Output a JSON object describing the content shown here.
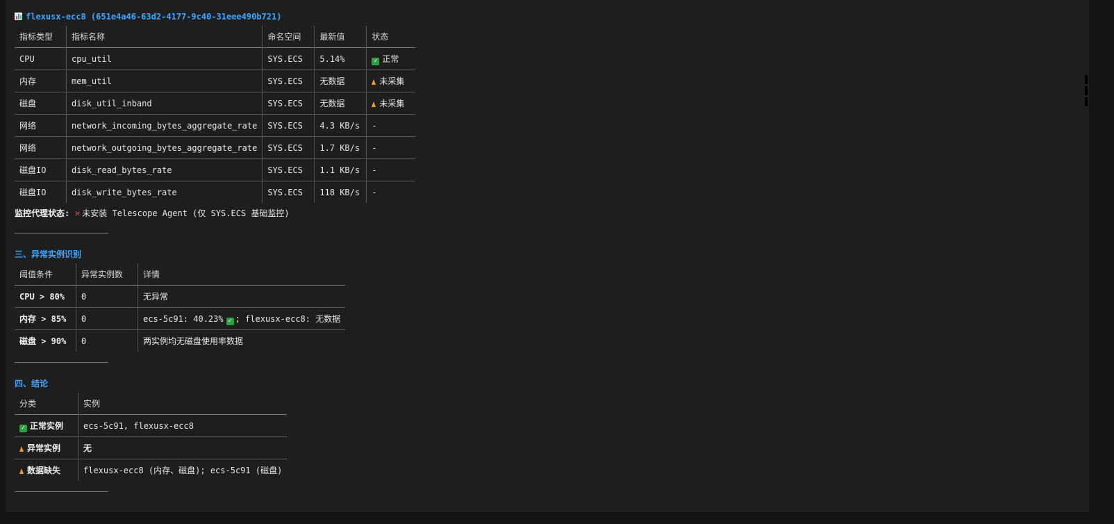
{
  "header": {
    "title": "flexusx-ecc8 (651e4a46-63d2-4177-9c40-31eee490b721)",
    "icon": "bar-chart-icon"
  },
  "metrics_table": {
    "columns": [
      "指标类型",
      "指标名称",
      "命名空间",
      "最新值",
      "状态"
    ],
    "rows": [
      {
        "type": "CPU",
        "name": "cpu_util",
        "namespace": "SYS.ECS",
        "value": "5.14%",
        "status": "正常",
        "status_icon": "check-icon"
      },
      {
        "type": "内存",
        "name": "mem_util",
        "namespace": "SYS.ECS",
        "value": "无数据",
        "status": "未采集",
        "status_icon": "warning-icon"
      },
      {
        "type": "磁盘",
        "name": "disk_util_inband",
        "namespace": "SYS.ECS",
        "value": "无数据",
        "status": "未采集",
        "status_icon": "warning-icon"
      },
      {
        "type": "网络",
        "name": "network_incoming_bytes_aggregate_rate",
        "namespace": "SYS.ECS",
        "value": "4.3 KB/s",
        "status": "-",
        "status_icon": ""
      },
      {
        "type": "网络",
        "name": "network_outgoing_bytes_aggregate_rate",
        "namespace": "SYS.ECS",
        "value": "1.7 KB/s",
        "status": "-",
        "status_icon": ""
      },
      {
        "type": "磁盘IO",
        "name": "disk_read_bytes_rate",
        "namespace": "SYS.ECS",
        "value": "1.1 KB/s",
        "status": "-",
        "status_icon": ""
      },
      {
        "type": "磁盘IO",
        "name": "disk_write_bytes_rate",
        "namespace": "SYS.ECS",
        "value": "118 KB/s",
        "status": "-",
        "status_icon": ""
      }
    ]
  },
  "agent_status": {
    "label": "监控代理状态:",
    "icon": "cross-icon",
    "text": "未安装 Telescope Agent (仅 SYS.ECS 基础监控)"
  },
  "section3": {
    "title": "三、异常实例识别",
    "columns": [
      "阈值条件",
      "异常实例数",
      "详情"
    ],
    "rows": [
      {
        "condition": "CPU > 80%",
        "count": "0",
        "detail_a": "无异常",
        "detail_b": ""
      },
      {
        "condition": "内存 > 85%",
        "count": "0",
        "detail_a": "ecs-5c91: 40.23%",
        "detail_b": "; flexusx-ecc8: 无数据"
      },
      {
        "condition": "磁盘 > 90%",
        "count": "0",
        "detail_a": "两实例均无磁盘使用率数据",
        "detail_b": ""
      }
    ]
  },
  "section4": {
    "title": "四、结论",
    "columns": [
      "分类",
      "实例"
    ],
    "rows": [
      {
        "category": "正常实例",
        "icon": "check-icon",
        "instances": "ecs-5c91, flexusx-ecc8"
      },
      {
        "category": "异常实例",
        "icon": "warning-icon",
        "instances": "无"
      },
      {
        "category": "数据缺失",
        "icon": "warning-icon",
        "instances": "flexusx-ecc8 (内存、磁盘); ecs-5c91 (磁盘)"
      }
    ]
  },
  "colors": {
    "background": "#1e1e1e",
    "heading": "#3ea6ff",
    "ok": "#2ea043",
    "warn": "#f0a030",
    "error": "#e5484d"
  }
}
